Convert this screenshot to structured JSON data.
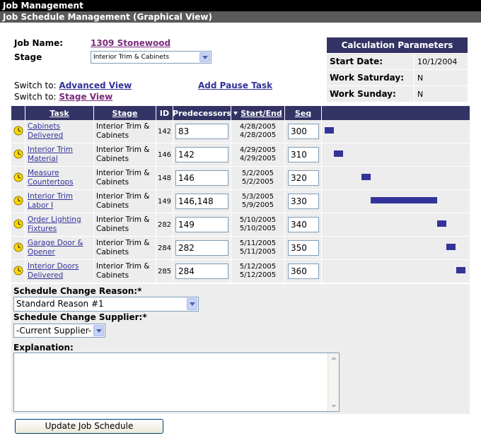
{
  "header": {
    "title": "Job Management",
    "subtitle": "Job Schedule Management (Graphical View)"
  },
  "job": {
    "name_label": "Job Name:",
    "name_value": "1309 Stonewood",
    "stage_label": "Stage",
    "stage_value": "Interior Trim & Cabinets"
  },
  "switch": {
    "prefix": "Switch to:",
    "advanced": "Advanced View",
    "stage": "Stage View",
    "add_pause": "Add Pause Task"
  },
  "calc": {
    "title": "Calculation Parameters",
    "rows": [
      {
        "key": "Start Date:",
        "value": "10/1/2004"
      },
      {
        "key": "Work Saturday:",
        "value": "N"
      },
      {
        "key": "Work Sunday:",
        "value": "N"
      }
    ]
  },
  "grid": {
    "headers": {
      "task": "Task",
      "stage": "Stage",
      "id": "ID",
      "pred": "Predecessors",
      "startend": "Start/End",
      "seq": "Seq"
    },
    "rows": [
      {
        "task": "Cabinets Delivered",
        "stage": "Interior Trim & Cabinets",
        "id": "142",
        "pred": "83",
        "start": "4/28/2005",
        "end": "4/28/2005",
        "seq": "300",
        "bar_start": 0.02,
        "bar_end": 0.08
      },
      {
        "task": "Interior Trim Material",
        "stage": "Interior Trim & Cabinets",
        "id": "146",
        "pred": "142",
        "start": "4/29/2005",
        "end": "4/29/2005",
        "seq": "310",
        "bar_start": 0.08,
        "bar_end": 0.14
      },
      {
        "task": "Measure Countertops",
        "stage": "Interior Trim & Cabinets",
        "id": "148",
        "pred": "146",
        "start": "5/2/2005",
        "end": "5/2/2005",
        "seq": "320",
        "bar_start": 0.27,
        "bar_end": 0.33
      },
      {
        "task": "Interior Trim Labor I",
        "stage": "Interior Trim & Cabinets",
        "id": "149",
        "pred": "146,148",
        "start": "5/3/2005",
        "end": "5/9/2005",
        "seq": "330",
        "bar_start": 0.33,
        "bar_end": 0.78
      },
      {
        "task": "Order Lighting Fixtures",
        "stage": "Interior Trim & Cabinets",
        "id": "282",
        "pred": "149",
        "start": "5/10/2005",
        "end": "5/10/2005",
        "seq": "340",
        "bar_start": 0.78,
        "bar_end": 0.84
      },
      {
        "task": "Garage Door & Opener",
        "stage": "Interior Trim & Cabinets",
        "id": "284",
        "pred": "282",
        "start": "5/11/2005",
        "end": "5/11/2005",
        "seq": "350",
        "bar_start": 0.84,
        "bar_end": 0.9
      },
      {
        "task": "Interior Doors Delivered",
        "stage": "Interior Trim & Cabinets",
        "id": "285",
        "pred": "284",
        "start": "5/12/2005",
        "end": "5/12/2005",
        "seq": "360",
        "bar_start": 0.91,
        "bar_end": 0.97
      }
    ]
  },
  "form": {
    "reason_label": "Schedule Change Reason:*",
    "reason_value": "Standard Reason #1",
    "supplier_label": "Schedule Change Supplier:*",
    "supplier_value": "-Current Supplier-",
    "explanation_label": "Explanation:"
  },
  "button": {
    "update": "Update Job Schedule"
  },
  "colors": {
    "header_bg": "#333366",
    "bar": "#333399",
    "row_bg": "#ededed",
    "icon": "#ffd700"
  }
}
